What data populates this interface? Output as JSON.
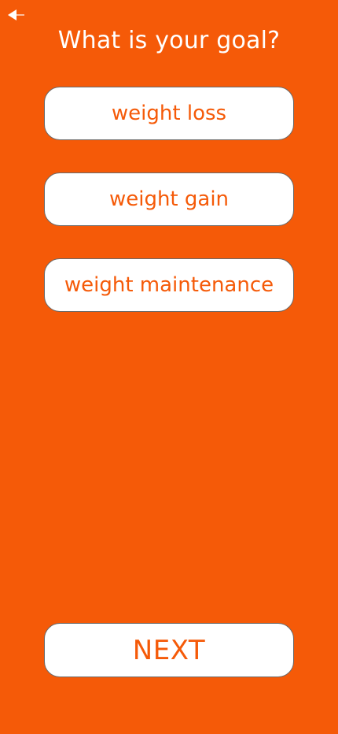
{
  "header": {
    "back_icon": "back-arrow-icon",
    "title": "What is your goal?"
  },
  "options": [
    {
      "label": "weight loss"
    },
    {
      "label": "weight gain"
    },
    {
      "label": "weight maintenance"
    }
  ],
  "footer": {
    "next_label": "NEXT"
  },
  "colors": {
    "background": "#F55A08",
    "button_bg": "#FFFFFF",
    "button_text": "#F55A08",
    "button_border": "#6A6A6A",
    "title_text": "#FFFFFF"
  }
}
